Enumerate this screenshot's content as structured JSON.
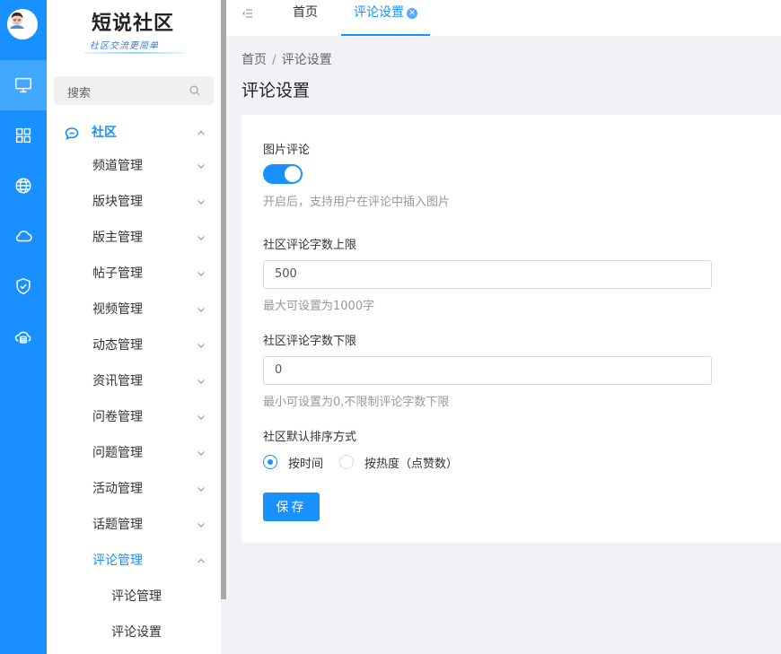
{
  "app": {
    "logo_title": "短说社区",
    "logo_subtitle": "社区交流更简单"
  },
  "rail": {
    "items": [
      {
        "icon": "monitor-icon",
        "active": true
      },
      {
        "icon": "grid-icon"
      },
      {
        "icon": "globe-icon"
      },
      {
        "icon": "cloud-icon"
      },
      {
        "icon": "shield-icon"
      },
      {
        "icon": "cloud-storage-icon"
      }
    ]
  },
  "sidebar": {
    "search_placeholder": "搜索",
    "group_label": "社区",
    "items": [
      "频道管理",
      "版块管理",
      "版主管理",
      "帖子管理",
      "视频管理",
      "动态管理",
      "资讯管理",
      "问卷管理",
      "问题管理",
      "活动管理",
      "话题管理",
      "评论管理"
    ],
    "sub_items": [
      "评论管理",
      "评论设置"
    ]
  },
  "tabs": {
    "home": "首页",
    "current": "评论设置"
  },
  "breadcrumb": {
    "home": "首页",
    "sep": "/",
    "current": "评论设置"
  },
  "page": {
    "title": "评论设置"
  },
  "form": {
    "image_comment": {
      "label": "图片评论",
      "enabled": true,
      "hint": "开启后，支持用户在评论中插入图片"
    },
    "max_chars": {
      "label": "社区评论字数上限",
      "value": "500",
      "hint": "最大可设置为1000字"
    },
    "min_chars": {
      "label": "社区评论字数下限",
      "value": "0",
      "hint": "最小可设置为0,不限制评论字数下限"
    },
    "sort": {
      "label": "社区默认排序方式",
      "options": [
        "按时间",
        "按热度（点赞数）"
      ],
      "selected": "按时间"
    },
    "save_label": "保存"
  },
  "colors": {
    "accent": "#1890ff"
  }
}
